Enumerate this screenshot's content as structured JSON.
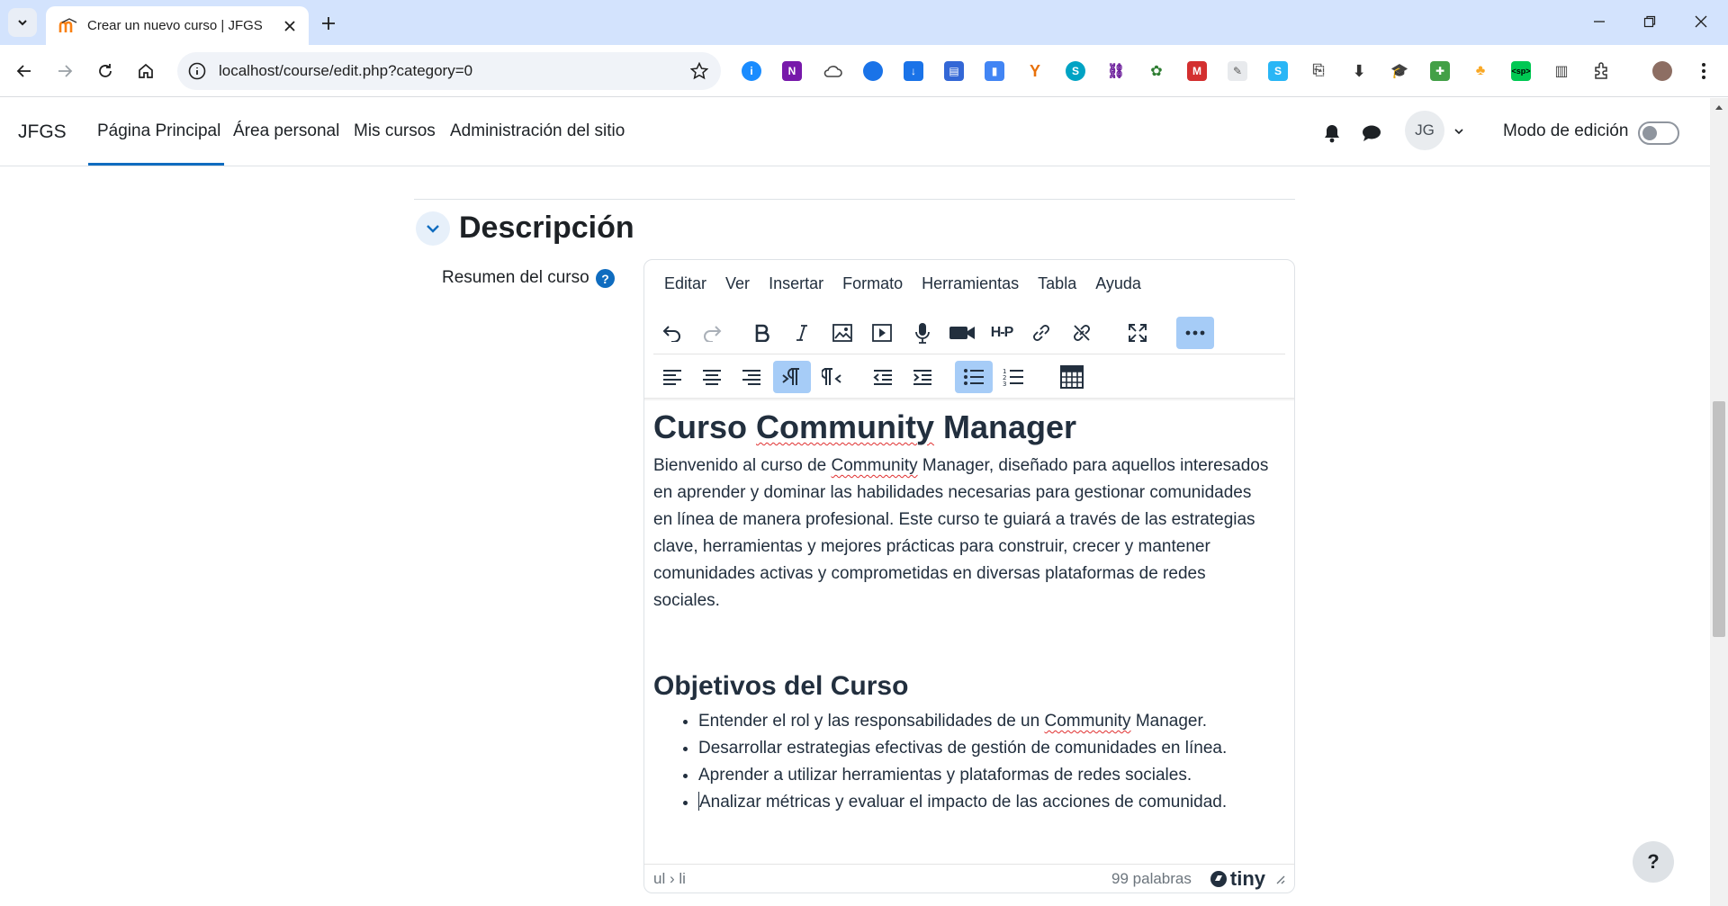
{
  "browser": {
    "tab_title": "Crear un nuevo curso | JFGS",
    "url": "localhost/course/edit.php?category=0",
    "extensions": [
      "1password-icon",
      "onenote-icon",
      "cloud-icon",
      "chrome-ext-icon",
      "download-ext-icon",
      "save-ext-icon",
      "doc-ext-icon",
      "y-ext-icon",
      "s-ext-icon",
      "link-ext-icon",
      "bird-ext-icon",
      "m-ext-icon",
      "note-ext-icon",
      "s2-ext-icon",
      "pages-ext-icon",
      "download-icon",
      "graduation-icon",
      "puzzle-green-icon",
      "tree-icon",
      "sp-ext-icon",
      "trash-ext-icon",
      "extensions-icon"
    ]
  },
  "nav": {
    "brand": "JFGS",
    "links": [
      "Página Principal",
      "Área personal",
      "Mis cursos",
      "Administración del sitio"
    ],
    "active_link": "Página Principal",
    "avatar_initials": "JG",
    "edit_mode_label": "Modo de edición"
  },
  "section": {
    "title": "Descripción",
    "field_label": "Resumen del curso",
    "help_glyph": "?"
  },
  "editor": {
    "menu": [
      "Editar",
      "Ver",
      "Insertar",
      "Formato",
      "Herramientas",
      "Tabla",
      "Ayuda"
    ],
    "content": {
      "heading": "Curso Community Manager",
      "heading_parts": [
        "Curso ",
        "Community",
        " Manager"
      ],
      "intro_parts": [
        "Bienvenido al curso de ",
        "Community",
        " Manager, diseñado para aquellos interesados en aprender y dominar las habilidades necesarias para gestionar comunidades en línea de manera profesional. Este curso te guiará a través de las estrategias clave, herramientas y mejores prácticas para construir, crecer y mantener comunidades activas y comprometidas en diversas plataformas de redes sociales."
      ],
      "subheading": "Objetivos del Curso",
      "objectives": [
        "Entender el rol y las responsabilidades de un Community Manager.",
        "Desarrollar estrategias efectivas de gestión de comunidades en línea.",
        "Aprender a utilizar herramientas y plataformas de redes sociales.",
        "Analizar métricas y evaluar el impacto de las acciones de comunidad."
      ],
      "objective1_parts": [
        "Entender el rol y las responsabilidades de un ",
        "Community",
        " Manager."
      ]
    },
    "status": {
      "path": "ul › li",
      "word_count": "99 palabras",
      "logo": "tiny"
    }
  },
  "float_help": "?",
  "colors": {
    "accent": "#0f6cbf",
    "tab_strip": "#d3e3fd",
    "toolbar_active": "#a6ccf7",
    "spellcheck": "#e03030"
  }
}
